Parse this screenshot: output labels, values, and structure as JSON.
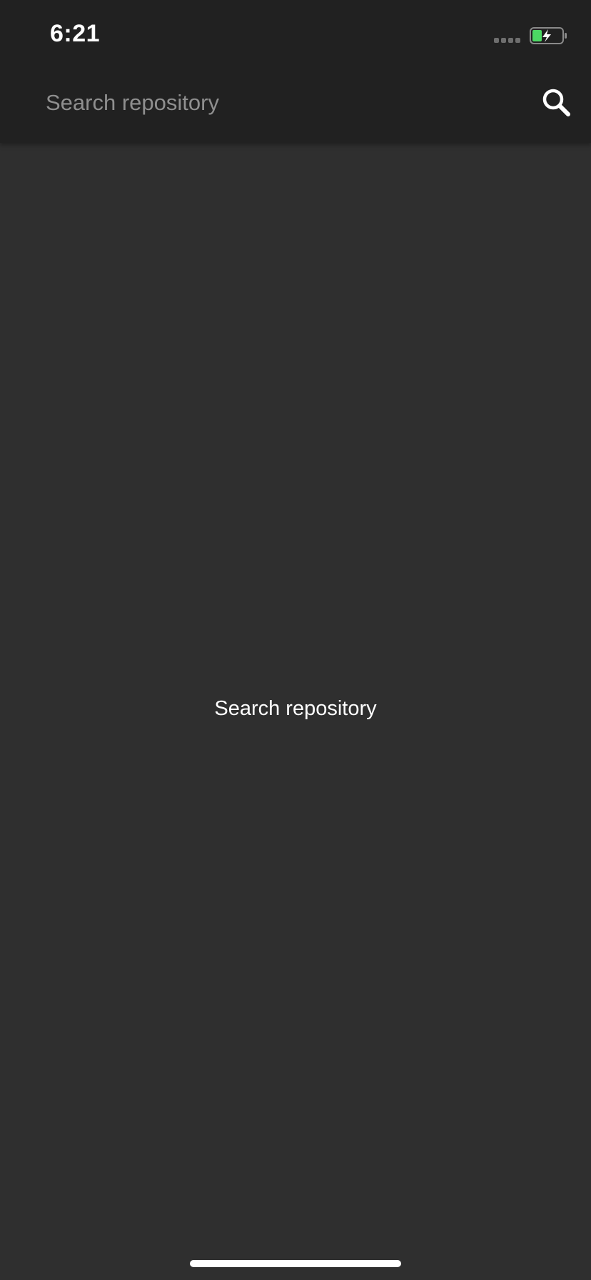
{
  "status_bar": {
    "time": "6:21",
    "battery_color": "#4cd964",
    "signal_icon": "signal-dots-icon",
    "battery_icon": "battery-charging-icon"
  },
  "search": {
    "placeholder": "Search repository",
    "value": "",
    "button_icon": "search-icon"
  },
  "main": {
    "empty_message": "Search repository"
  },
  "colors": {
    "header_background": "#212121",
    "content_background": "#2f2f2f",
    "text_primary": "#ffffff",
    "text_placeholder": "#8f8f8f"
  }
}
